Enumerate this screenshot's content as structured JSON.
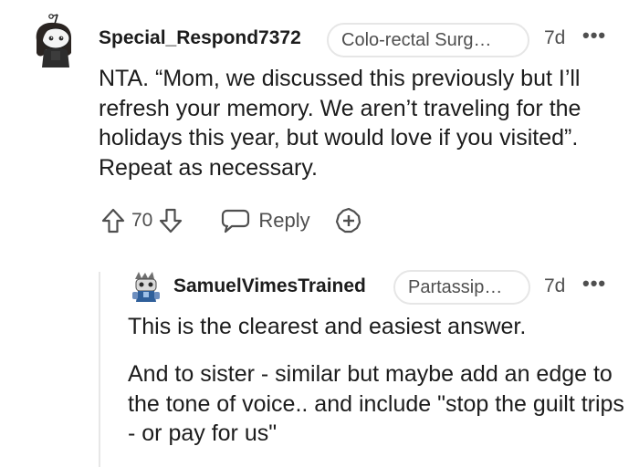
{
  "comments": [
    {
      "author": "Special_Respond7372",
      "flair": "Colo-rectal Surg…",
      "time": "7d",
      "more": "•••",
      "body": "NTA. “Mom, we discussed this previously but I’ll refresh your memory. We aren’t traveling for the holidays this year, but would love if you visited”. Repeat as necessary.",
      "score": "70",
      "reply_label": "Reply",
      "icons": [
        "upvote-icon",
        "downvote-icon",
        "reply-bubble-icon",
        "award-plus-icon",
        "more-icon"
      ]
    },
    {
      "author": "SamuelVimesTrained",
      "flair": "Partassip…",
      "time": "7d",
      "more": "•••",
      "body_p1": "This is the clearest and easiest answer.",
      "body_p2": "And to sister - similar but maybe add an edge to the tone of voice.. and include \"stop the guilt trips - or pay for us\""
    }
  ],
  "colors": {
    "text": "#1c1c1c",
    "meta": "#4f4f4f",
    "border": "#e6e6e6",
    "thread_line": "#e7e7e7"
  }
}
